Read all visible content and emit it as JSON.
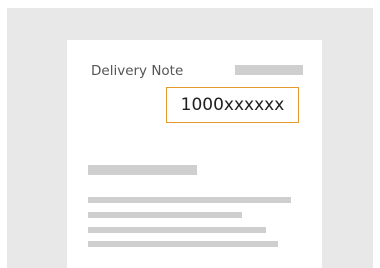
{
  "document": {
    "title": "Delivery Note",
    "number": "1000xxxxxx"
  },
  "colors": {
    "background": "#e8e8e8",
    "paper": "#ffffff",
    "placeholder_bar": "#cfcfcf",
    "highlight_border": "#e39b2d"
  }
}
